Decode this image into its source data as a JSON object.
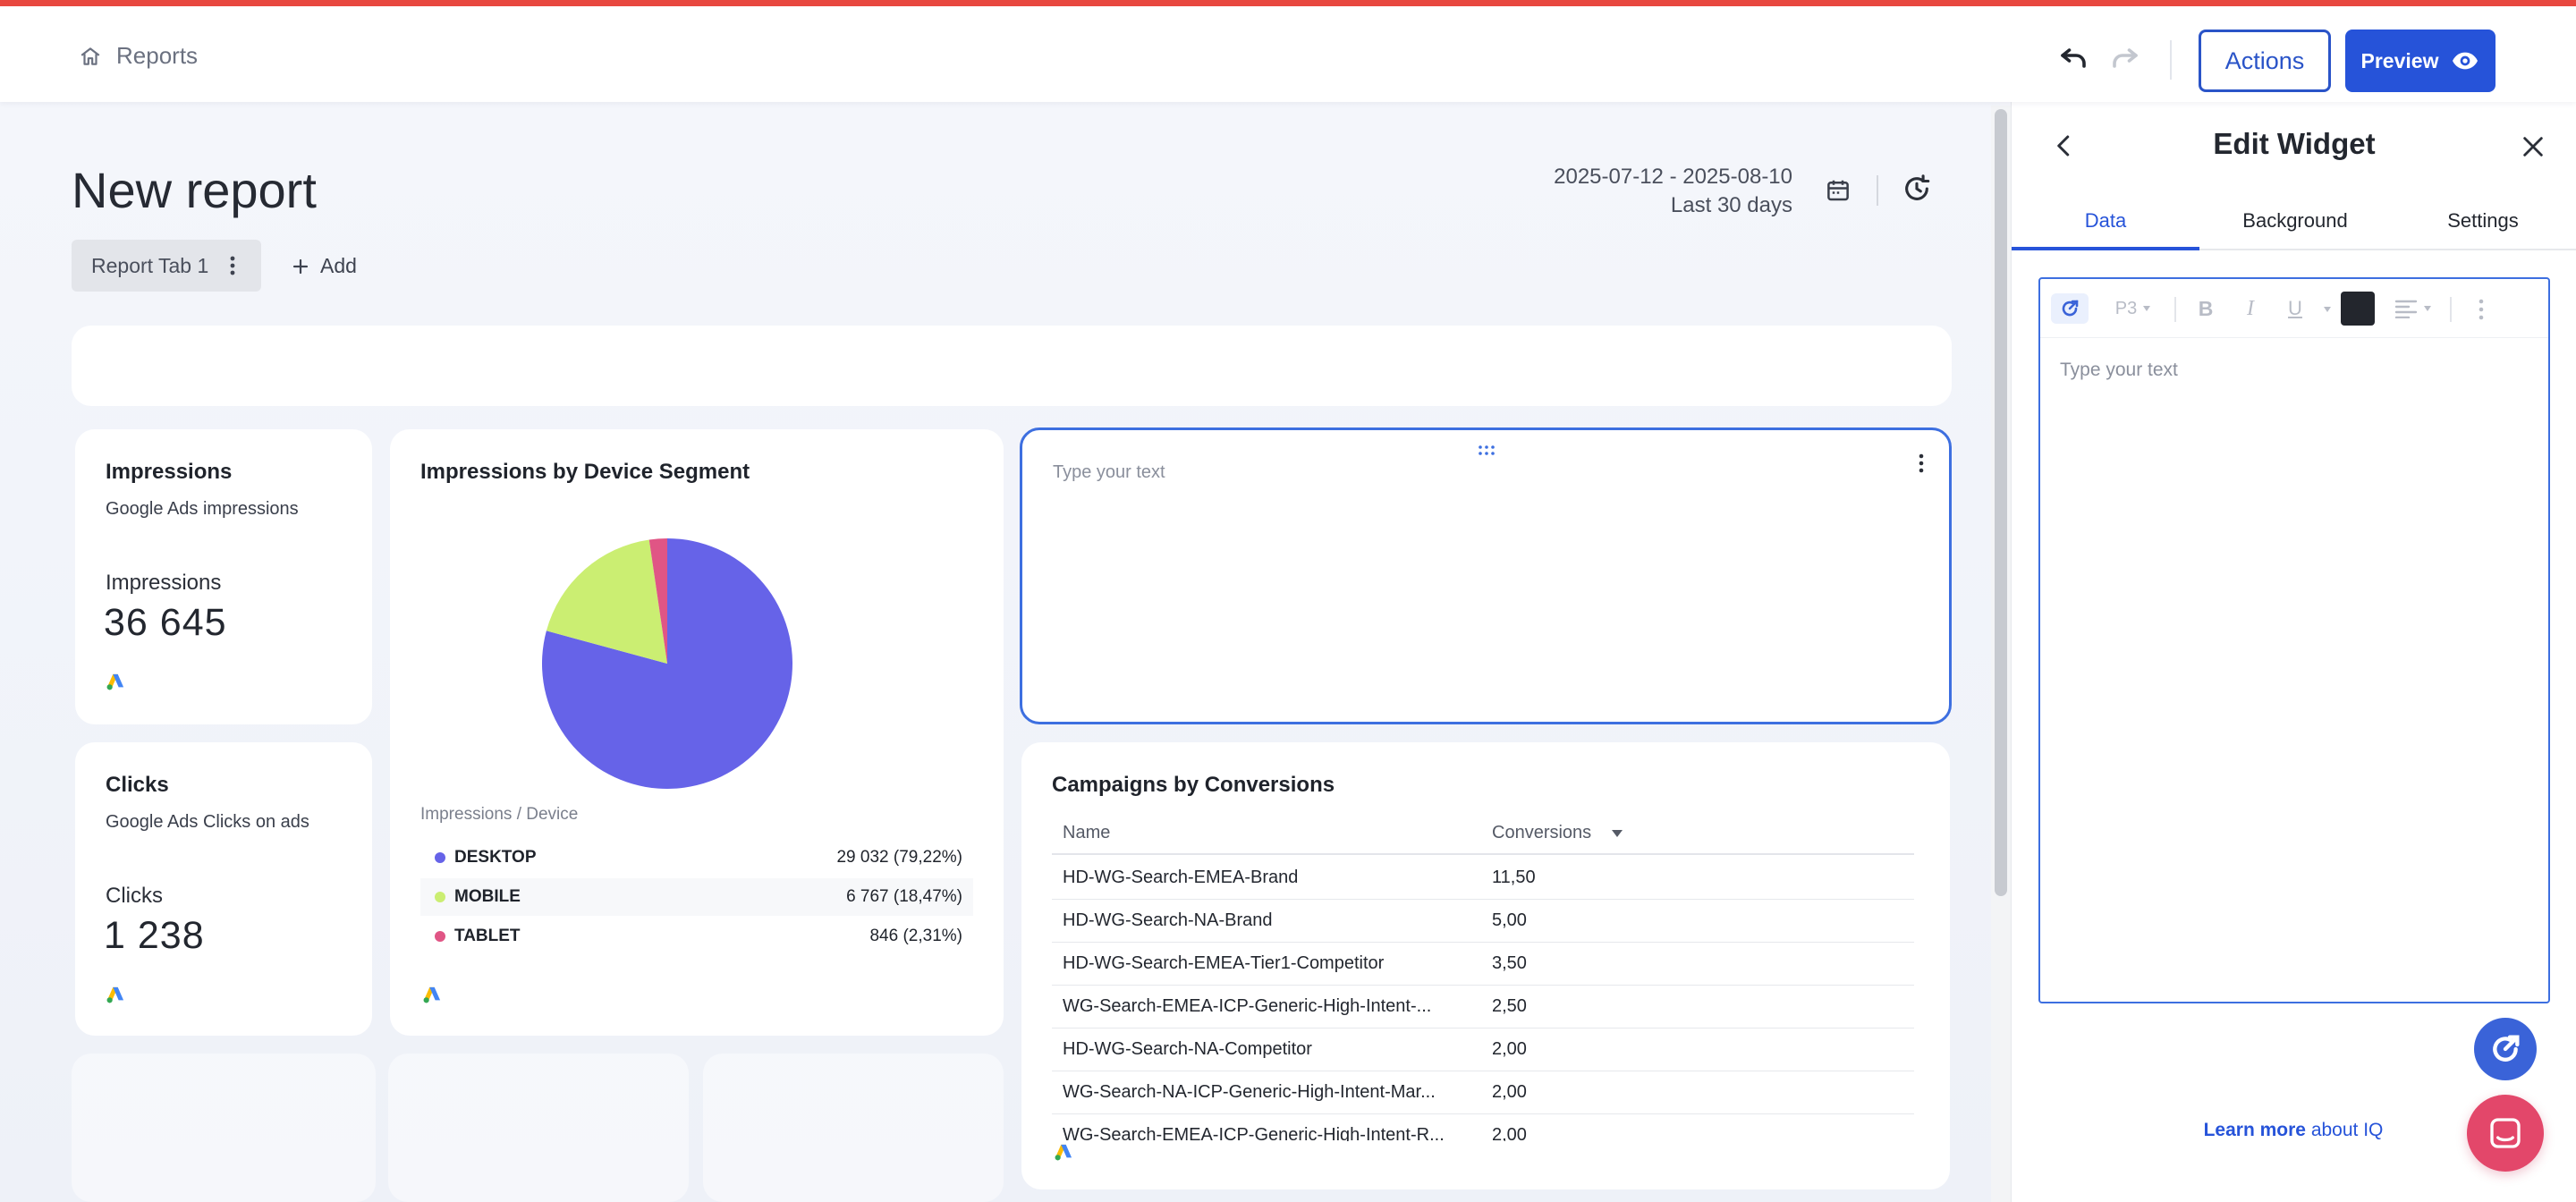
{
  "breadcrumb": {
    "label": "Reports"
  },
  "toolbar": {
    "actions_label": "Actions",
    "preview_label": "Preview"
  },
  "report": {
    "title": "New report",
    "date_range": "2025-07-12 - 2025-08-10",
    "date_preset": "Last 30 days",
    "tabs": [
      {
        "label": "Report Tab 1"
      }
    ],
    "add_tab_label": "Add"
  },
  "widgets": {
    "impressions": {
      "title": "Impressions",
      "subtitle": "Google Ads impressions",
      "metric_label": "Impressions",
      "value": "36 645"
    },
    "clicks": {
      "title": "Clicks",
      "subtitle": "Google Ads Clicks on ads",
      "metric_label": "Clicks",
      "value": "1 238"
    },
    "device": {
      "title": "Impressions by Device Segment",
      "caption": "Impressions / Device",
      "legend": [
        {
          "name": "DESKTOP",
          "value": "29 032",
          "pct": "(79,22%)",
          "color": "#6663e8"
        },
        {
          "name": "MOBILE",
          "value": "6 767",
          "pct": "(18,47%)",
          "color": "#cbee72"
        },
        {
          "name": "TABLET",
          "value": "846",
          "pct": "(2,31%)",
          "color": "#e05585"
        }
      ]
    },
    "text": {
      "placeholder": "Type your text"
    },
    "campaigns": {
      "title": "Campaigns by Conversions",
      "columns": {
        "name": "Name",
        "conversions": "Conversions"
      },
      "rows": [
        {
          "name": "HD-WG-Search-EMEA-Brand",
          "conversions": "11,50"
        },
        {
          "name": "HD-WG-Search-NA-Brand",
          "conversions": "5,00"
        },
        {
          "name": "HD-WG-Search-EMEA-Tier1-Competitor",
          "conversions": "3,50"
        },
        {
          "name": "WG-Search-EMEA-ICP-Generic-High-Intent-...",
          "conversions": "2,50"
        },
        {
          "name": "HD-WG-Search-NA-Competitor",
          "conversions": "2,00"
        },
        {
          "name": "WG-Search-NA-ICP-Generic-High-Intent-Mar...",
          "conversions": "2,00"
        },
        {
          "name": "WG-Search-EMEA-ICP-Generic-High-Intent-R...",
          "conversions": "2,00"
        }
      ]
    }
  },
  "chart_data": {
    "type": "pie",
    "categories": [
      "DESKTOP",
      "MOBILE",
      "TABLET"
    ],
    "values": [
      29032,
      6767,
      846
    ],
    "colors": [
      "#6663e8",
      "#cbee72",
      "#e05585"
    ]
  },
  "panel": {
    "title": "Edit Widget",
    "tabs": [
      {
        "label": "Data"
      },
      {
        "label": "Background"
      },
      {
        "label": "Settings"
      }
    ],
    "active_tab": "Data",
    "editor": {
      "font_style": "P3",
      "placeholder": "Type your text",
      "text_color": "#23262d"
    },
    "learn_more": "Learn more",
    "learn_more_suffix": "about IQ"
  },
  "colors": {
    "accent": "#2653d9",
    "top_strip": "#e8483f",
    "chat": "#e3476a"
  }
}
